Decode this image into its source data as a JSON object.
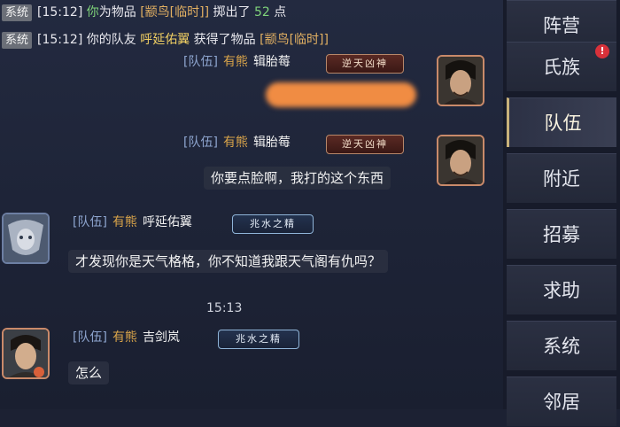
{
  "system_lines": [
    {
      "tag": "系统",
      "time": "[15:12]",
      "parts": [
        "你",
        "为物品",
        "[颛鸟[临时]]",
        "掷出了",
        "52",
        "点"
      ]
    },
    {
      "tag": "系统",
      "time": "[15:12]",
      "parts": [
        "你的队友",
        "呼延佑翼",
        "获得了物品",
        "[颛鸟[临时]]"
      ]
    }
  ],
  "messages": [
    {
      "channel": "[队伍]",
      "family": "有熊",
      "name": "辑胎莓",
      "badge": "逆天凶神",
      "text": ""
    },
    {
      "channel": "[队伍]",
      "family": "有熊",
      "name": "辑胎莓",
      "badge": "逆天凶神",
      "text": "你要点脸啊，我打的这个东西"
    },
    {
      "channel": "[队伍]",
      "family": "有熊",
      "name": "呼延佑翼",
      "badge": "兆水之精",
      "text": "才发现你是天气格格，你不知道我跟天气阁有仇吗？"
    },
    {
      "channel": "[队伍]",
      "family": "有熊",
      "name": "吉剑岚",
      "badge": "兆水之精",
      "text": "怎么"
    }
  ],
  "timestamp": "15:13",
  "sidebar": {
    "tabs": [
      "阵营",
      "氏族",
      "队伍",
      "附近",
      "招募",
      "求助",
      "系统",
      "邻居"
    ],
    "active": "队伍",
    "alert_mark": "!"
  },
  "colors": {
    "accent_gold": "#e2b062",
    "system_green": "#7fd37a",
    "alert_red": "#d8313a"
  }
}
